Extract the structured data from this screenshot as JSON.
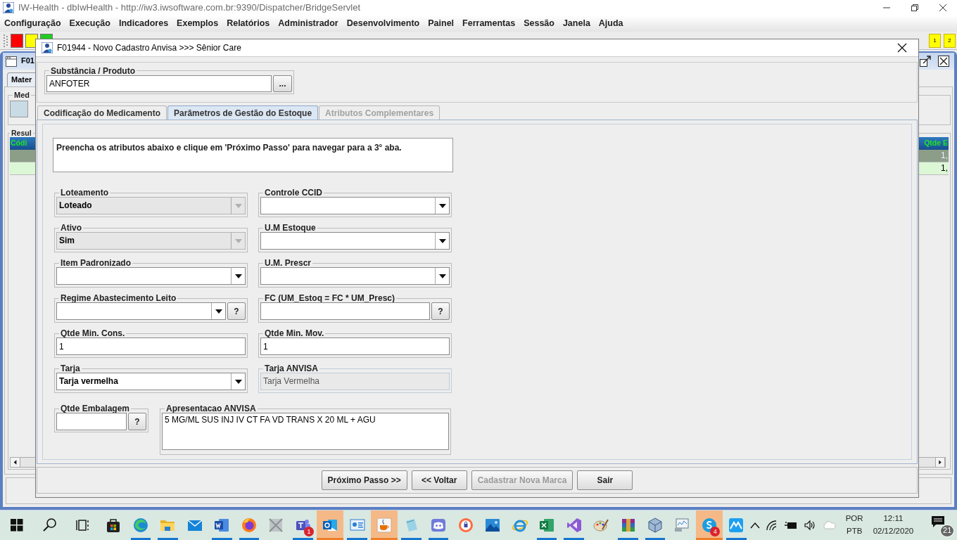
{
  "app": {
    "title": "IW-Health - dbIwHealth - http://iw3.iwsoftware.com.br:9390/Dispatcher/BridgeServlet",
    "menu": [
      "Configuração",
      "Execução",
      "Indicadores",
      "Exemplos",
      "Relatórios",
      "Administrador",
      "Desenvolvimento",
      "Painel",
      "Ferramentas",
      "Sessão",
      "Janela",
      "Ajuda"
    ],
    "workspaces": [
      "1",
      "2"
    ]
  },
  "background_frame": {
    "title": "F01",
    "tab": "Mater",
    "group": "Med",
    "results_group": "Resul",
    "columns": [
      "Códi",
      "Qtde E"
    ],
    "rows": [
      {
        "value": "1,",
        "selected": true
      },
      {
        "value": "1,",
        "selected": false
      }
    ]
  },
  "dialog": {
    "title": "F01944 - Novo Cadastro Anvisa >>> Sênior Care",
    "product_label": "Substância / Produto",
    "product_value": "ANFOTER",
    "browse_button": "...",
    "tabs": [
      {
        "label": "Codificação do Medicamento",
        "selected": false,
        "disabled": false
      },
      {
        "label": "Parâmetros de Gestão do Estoque",
        "selected": true,
        "disabled": false
      },
      {
        "label": "Atributos Complementares",
        "selected": false,
        "disabled": true
      }
    ],
    "instructions": "Preencha os atributos abaixo e clique em 'Próximo Passo' para navegar para a 3° aba.",
    "fields": [
      {
        "kind": "select",
        "label": "Loteamento",
        "value": "Loteado",
        "disabled": true
      },
      {
        "kind": "select",
        "label": "Controle CCID",
        "disabled": false
      },
      {
        "kind": "select",
        "label": "Ativo",
        "value": "Sim",
        "disabled": true
      },
      {
        "kind": "select",
        "label": "U.M Estoque",
        "disabled": false
      },
      {
        "kind": "select",
        "label": "Item Padronizado",
        "disabled": false
      },
      {
        "kind": "select",
        "label": "U.M. Prescr",
        "disabled": false
      },
      {
        "kind": "select-help",
        "label": "Regime Abastecimento Leito",
        "help": "?"
      },
      {
        "kind": "text-help",
        "label": "FC (UM_Estoq = FC * UM_Presc)",
        "help": "?"
      },
      {
        "kind": "text",
        "label": "Qtde Min. Cons.",
        "value": "1"
      },
      {
        "kind": "text",
        "label": "Qtde Min. Mov.",
        "value": "1"
      },
      {
        "kind": "select",
        "label": "Tarja",
        "value": "Tarja vermelha",
        "disabled": false
      },
      {
        "kind": "readonly",
        "label": "Tarja ANVISA",
        "value": "Tarja Vermelha"
      }
    ],
    "bottom_fields": [
      {
        "kind": "text-help",
        "label": "Qtde Embalagem",
        "help": "?"
      },
      {
        "kind": "textarea",
        "label": "Apresentacao ANVISA",
        "value": "5 MG/ML SUS INJ IV CT FA VD TRANS X 20 ML + AGU"
      }
    ],
    "buttons": [
      {
        "label": "Próximo Passo >>",
        "disabled": false
      },
      {
        "label": "<< Voltar",
        "disabled": false
      },
      {
        "label": "Cadastrar Nova Marca",
        "disabled": true
      },
      {
        "label": "Sair",
        "disabled": false
      }
    ]
  },
  "taskbar": {
    "apps": [
      {
        "kind": "start",
        "running": false,
        "active": false
      },
      {
        "kind": "search",
        "running": false,
        "active": false
      },
      {
        "kind": "task-view",
        "running": false,
        "active": false
      },
      {
        "kind": "store",
        "running": false,
        "active": false
      },
      {
        "kind": "edge",
        "running": true,
        "active": false
      },
      {
        "kind": "folder",
        "running": true,
        "active": false
      },
      {
        "kind": "mail",
        "running": false,
        "active": false
      },
      {
        "kind": "word",
        "running": true,
        "active": false
      },
      {
        "kind": "firefox",
        "running": true,
        "active": false
      },
      {
        "kind": "gray-app",
        "running": false,
        "active": false
      },
      {
        "kind": "teams",
        "running": true,
        "active": false,
        "badge": "1"
      },
      {
        "kind": "outlook",
        "running": true,
        "active": true
      },
      {
        "kind": "presentation",
        "running": true,
        "active": false
      },
      {
        "kind": "java",
        "running": true,
        "active": true
      },
      {
        "kind": "notepad",
        "running": true,
        "active": false
      },
      {
        "kind": "discord",
        "running": true,
        "active": false
      },
      {
        "kind": "shield-browser",
        "running": false,
        "active": false
      },
      {
        "kind": "photos",
        "running": false,
        "active": false
      },
      {
        "kind": "ie",
        "running": false,
        "active": false
      },
      {
        "kind": "excel",
        "running": true,
        "active": false
      },
      {
        "kind": "vs",
        "running": true,
        "active": false
      },
      {
        "kind": "paint",
        "running": false,
        "active": false
      },
      {
        "kind": "archive",
        "running": true,
        "active": false
      },
      {
        "kind": "cube",
        "running": true,
        "active": false
      },
      {
        "kind": "monitor",
        "running": false,
        "active": false
      },
      {
        "kind": "skype",
        "running": true,
        "active": true,
        "badge": "4"
      },
      {
        "kind": "mountain-app",
        "running": true,
        "active": false
      }
    ],
    "language": [
      "POR",
      "PTB"
    ],
    "time": "12:11",
    "date": "02/12/2020",
    "notifications": "21"
  }
}
